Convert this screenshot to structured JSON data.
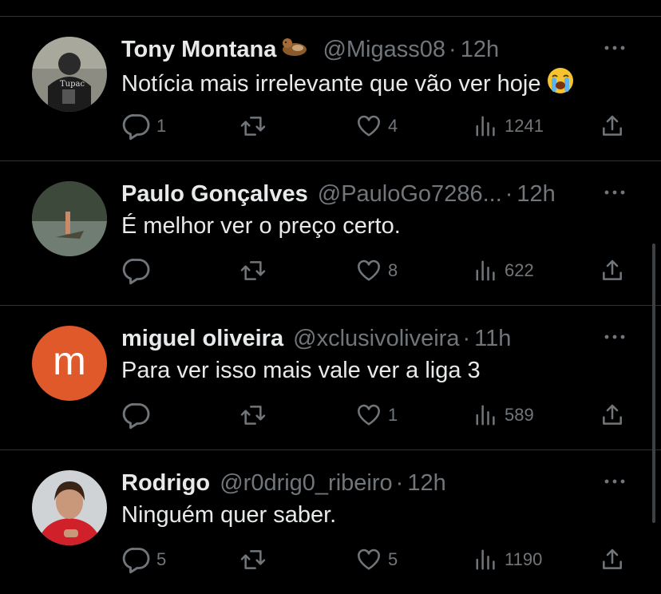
{
  "colors": {
    "background": "#000000",
    "text": "#e7e9ea",
    "muted": "#71767b",
    "divider": "#2f3336",
    "avatar_m": "#e0592a"
  },
  "icons": {
    "reply": "reply-icon",
    "retweet": "retweet-icon",
    "like": "heart-icon",
    "views": "views-icon",
    "share": "share-icon",
    "more": "more-icon"
  },
  "tweets": [
    {
      "name": "Tony Montana",
      "badge": "otter-emoji",
      "handle": "@Migass08",
      "separator": "·",
      "time": "12h",
      "text": "Notícia mais irrelevante que vão ver hoje",
      "text_emoji": "loudly-crying-face-emoji",
      "replies": "1",
      "retweets": "",
      "likes": "4",
      "views": "1241"
    },
    {
      "name": "Paulo Gonçalves",
      "handle": "@PauloGo7286...",
      "separator": "·",
      "time": "12h",
      "text": "É melhor ver o preço certo.",
      "replies": "",
      "retweets": "",
      "likes": "8",
      "views": "622"
    },
    {
      "name": "miguel oliveira",
      "handle": "@xclusivoliveira",
      "separator": "·",
      "time": "11h",
      "avatar_letter": "m",
      "text": "Para ver isso mais vale ver a liga 3",
      "replies": "",
      "retweets": "",
      "likes": "1",
      "views": "589"
    },
    {
      "name": "Rodrigo",
      "handle": "@r0drig0_ribeiro",
      "separator": "·",
      "time": "12h",
      "text": "Ninguém quer saber.",
      "replies": "5",
      "retweets": "",
      "likes": "5",
      "views": "1190"
    }
  ]
}
